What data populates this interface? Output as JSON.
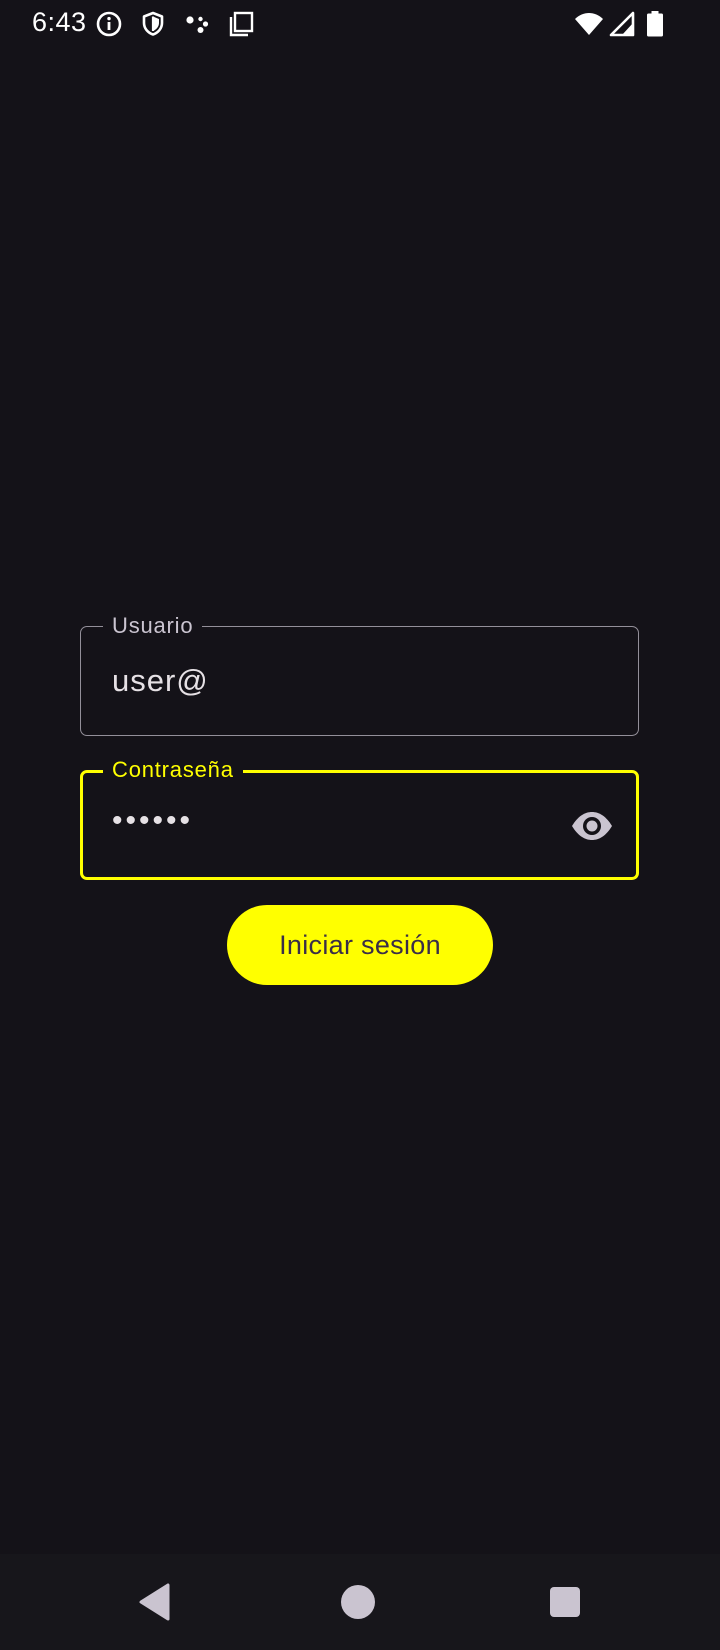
{
  "status_bar": {
    "time": "6:43",
    "icons": [
      "info-icon",
      "shield-icon",
      "assistant-dots-icon",
      "copy-icon",
      "wifi-icon",
      "cellular-signal-icon",
      "battery-icon"
    ]
  },
  "login_form": {
    "username": {
      "label": "Usuario",
      "value": "user@"
    },
    "password": {
      "label": "Contraseña",
      "value": "••••••",
      "toggle_icon": "eye-icon"
    },
    "submit_label": "Iniciar sesión"
  },
  "navigation_bar": {
    "buttons": [
      "back-icon",
      "home-icon",
      "recents-icon"
    ]
  },
  "colors": {
    "background": "#141218",
    "accent": "#FFFF00",
    "outline": "#938F99",
    "label": "#CAC4D0",
    "text": "#E6E1E5",
    "button_text": "#3A2E48",
    "nav_bar": "#17161B"
  }
}
